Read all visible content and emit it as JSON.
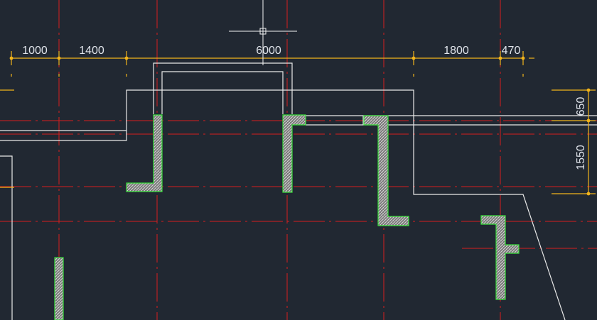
{
  "viewport": {
    "background": "#212832"
  },
  "colors": {
    "axis_line": "#d81e1e",
    "guide_line": "#e9e9e9",
    "dimension": "#f2b41b",
    "wall_fill": "#8c8c8c",
    "wall_outline": "#39e03b",
    "text": "#dfe3ea"
  },
  "dimensions": {
    "top": [
      "1000",
      "1400",
      "6000",
      "1800",
      "470"
    ],
    "right": [
      "650",
      "1550"
    ]
  }
}
